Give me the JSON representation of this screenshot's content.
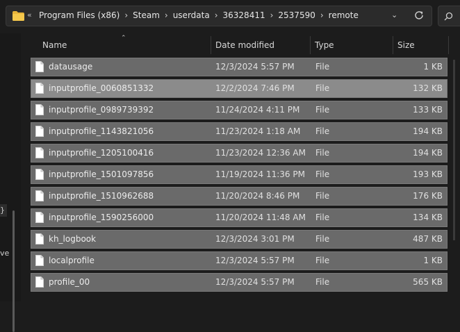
{
  "address": {
    "overflow_label": "«",
    "crumbs": [
      "Program Files (x86)",
      "Steam",
      "userdata",
      "36328411",
      "2537590",
      "remote"
    ],
    "separator": "›"
  },
  "nav": {
    "partial_text_1": "}",
    "partial_text_2": "ve"
  },
  "columns": {
    "name": "Name",
    "date": "Date modified",
    "type": "Type",
    "size": "Size"
  },
  "files": [
    {
      "name": "datausage",
      "date": "12/3/2024 5:57 PM",
      "type": "File",
      "size": "1 KB",
      "highlighted": false
    },
    {
      "name": "inputprofile_0060851332",
      "date": "12/2/2024 7:46 PM",
      "type": "File",
      "size": "132 KB",
      "highlighted": true
    },
    {
      "name": "inputprofile_0989739392",
      "date": "11/24/2024 4:11 PM",
      "type": "File",
      "size": "133 KB",
      "highlighted": false
    },
    {
      "name": "inputprofile_1143821056",
      "date": "11/23/2024 1:18 AM",
      "type": "File",
      "size": "194 KB",
      "highlighted": false
    },
    {
      "name": "inputprofile_1205100416",
      "date": "11/23/2024 12:36 AM",
      "type": "File",
      "size": "194 KB",
      "highlighted": false
    },
    {
      "name": "inputprofile_1501097856",
      "date": "11/19/2024 11:36 PM",
      "type": "File",
      "size": "193 KB",
      "highlighted": false
    },
    {
      "name": "inputprofile_1510962688",
      "date": "11/20/2024 8:46 PM",
      "type": "File",
      "size": "176 KB",
      "highlighted": false
    },
    {
      "name": "inputprofile_1590256000",
      "date": "11/20/2024 11:48 AM",
      "type": "File",
      "size": "134 KB",
      "highlighted": false
    },
    {
      "name": "kh_logbook",
      "date": "12/3/2024 3:01 PM",
      "type": "File",
      "size": "487 KB",
      "highlighted": false
    },
    {
      "name": "localprofile",
      "date": "12/3/2024 5:57 PM",
      "type": "File",
      "size": "1 KB",
      "highlighted": false
    },
    {
      "name": "profile_00",
      "date": "12/3/2024 5:57 PM",
      "type": "File",
      "size": "565 KB",
      "highlighted": false
    }
  ],
  "icons": {
    "folder": "folder-icon",
    "file": "file-icon",
    "refresh": "refresh-icon",
    "search": "search-icon",
    "dropdown": "chevron-down-icon",
    "sort": "sort-up-icon"
  }
}
